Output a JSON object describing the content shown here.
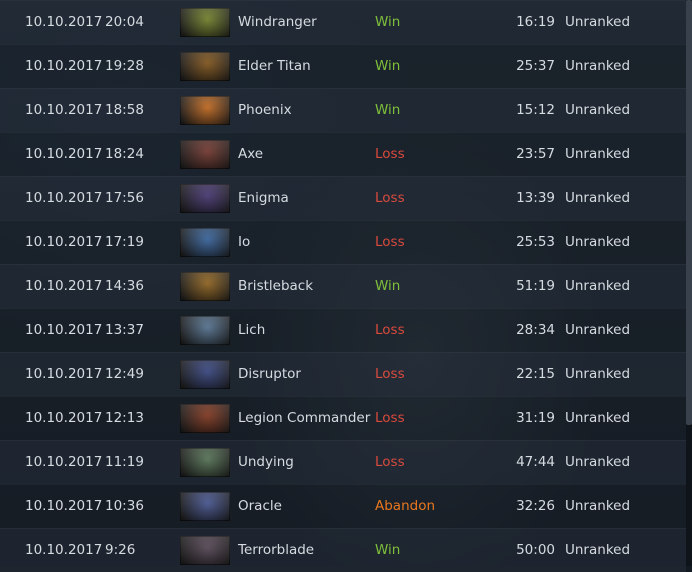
{
  "matches": [
    {
      "date": "10.10.2017",
      "time": "20:04",
      "hero": "Windranger",
      "result": "Win",
      "result_class": "win",
      "duration": "16:19",
      "mode": "Unranked",
      "portrait_color": "#7a8a2c"
    },
    {
      "date": "10.10.2017",
      "time": "19:28",
      "hero": "Elder Titan",
      "result": "Win",
      "result_class": "win",
      "duration": "25:37",
      "mode": "Unranked",
      "portrait_color": "#8a5a1c"
    },
    {
      "date": "10.10.2017",
      "time": "18:58",
      "hero": "Phoenix",
      "result": "Win",
      "result_class": "win",
      "duration": "15:12",
      "mode": "Unranked",
      "portrait_color": "#d07020"
    },
    {
      "date": "10.10.2017",
      "time": "18:24",
      "hero": "Axe",
      "result": "Loss",
      "result_class": "loss",
      "duration": "23:57",
      "mode": "Unranked",
      "portrait_color": "#7a3a30"
    },
    {
      "date": "10.10.2017",
      "time": "17:56",
      "hero": "Enigma",
      "result": "Loss",
      "result_class": "loss",
      "duration": "13:39",
      "mode": "Unranked",
      "portrait_color": "#4a3a7a"
    },
    {
      "date": "10.10.2017",
      "time": "17:19",
      "hero": "Io",
      "result": "Loss",
      "result_class": "loss",
      "duration": "25:53",
      "mode": "Unranked",
      "portrait_color": "#3a6aa8"
    },
    {
      "date": "10.10.2017",
      "time": "14:36",
      "hero": "Bristleback",
      "result": "Win",
      "result_class": "win",
      "duration": "51:19",
      "mode": "Unranked",
      "portrait_color": "#9a6a20"
    },
    {
      "date": "10.10.2017",
      "time": "13:37",
      "hero": "Lich",
      "result": "Loss",
      "result_class": "loss",
      "duration": "28:34",
      "mode": "Unranked",
      "portrait_color": "#5a7a9a"
    },
    {
      "date": "10.10.2017",
      "time": "12:49",
      "hero": "Disruptor",
      "result": "Loss",
      "result_class": "loss",
      "duration": "22:15",
      "mode": "Unranked",
      "portrait_color": "#3a4a8a"
    },
    {
      "date": "10.10.2017",
      "time": "12:13",
      "hero": "Legion Commander",
      "result": "Loss",
      "result_class": "loss",
      "duration": "31:19",
      "mode": "Unranked",
      "portrait_color": "#8a3a20"
    },
    {
      "date": "10.10.2017",
      "time": "11:19",
      "hero": "Undying",
      "result": "Loss",
      "result_class": "loss",
      "duration": "47:44",
      "mode": "Unranked",
      "portrait_color": "#5a7a5a"
    },
    {
      "date": "10.10.2017",
      "time": "10:36",
      "hero": "Oracle",
      "result": "Abandon",
      "result_class": "abandon",
      "duration": "32:26",
      "mode": "Unranked",
      "portrait_color": "#4a5a9a"
    },
    {
      "date": "10.10.2017",
      "time": "9:26",
      "hero": "Terrorblade",
      "result": "Win",
      "result_class": "win",
      "duration": "50:00",
      "mode": "Unranked",
      "portrait_color": "#5a4a5a"
    }
  ]
}
